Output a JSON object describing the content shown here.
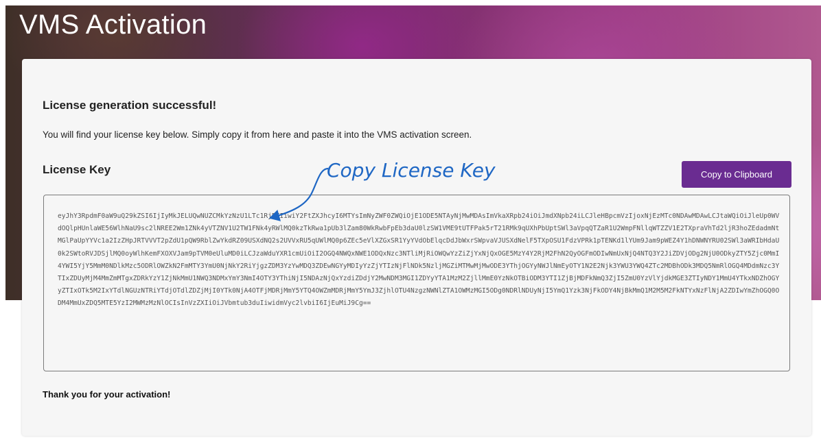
{
  "page": {
    "title": "VMS Activation"
  },
  "card": {
    "heading": "License generation successful!",
    "intro": "You will find your license key below. Simply copy it from here and paste it into the VMS activation screen.",
    "key_label": "License Key",
    "copy_button_label": "Copy to Clipboard",
    "license_key": "eyJhY3RpdmF0aW9uQ29kZSI6IjIyMkJELUQwNUZCMkYzNzU1LTc1RjBFIiwiY2FtZXJhcyI6MTYsImNyZWF0ZWQiOjE1ODE5NTAyNjMwMDAsImVkaXRpb24iOiJmdXNpb24iLCJleHBpcmVzIjoxNjEzMTc0NDAwMDAwLCJtaWQiOiJleUp0WVdOQlpHUnlaWE56WlhNaU9sc2lNREE2Wm1ZNk4yVTZNV1U2TW1FNk4yRWlMQ0kzTkRwa1pUb3lZam80WkRwbFpEb3daU0lzSW1VME9tUTFPak5rT21RMk9qUXhPbUptSWl3aVpqQTZaR1U2WmpFNllqWTZZV1E2TXpraVhTd2ljR3hoZEdadmNtMGlPaUpYYVc1a2IzZHpJRTVVVT2pZdU1pQW9RblZwYkdRZ09USXdNQ2s2UVVxRU5qUWlMQ0p6ZEc5eVlXZGxSR1YyYVdObElqcDdJbWxrSWpvaVJUSXdNelF5TXpOSU1FdzVPRk1pTENKd1lYUm9Jam9pWEZ4Y1hDNWNYRU02SWl3aWRIbHdaU0k2SWtoRVJDSjlMQ0oyWlhKemFXOXVJam9pTVM0eUluMD0iLCJzaWduYXR1cmUiOiI2OGQ4NWQxNWE1ODQxNzc3NTliMjRiOWQwYzZiZjYxNjQxOGE5MzY4Y2RjM2FhN2QyOGFmODIwNmUxNjQ4NTQ3Y2JiZDVjODg2NjU0ODkyZTY5Zjc0MmI4YWI5YjY5MmM0NDlkMzc5ODRlOWZkN2FmMTY3YmU0NjNkY2RiYjgzZDM3YzYwMDQ3ZDEwNGYyMDIyYzZjYTIzNjFlNDk5NzljMGZiMTMwMjMwODE3YThjOGYyNWJlNmEyOTY1N2E2Njk3YWU3YWQ4ZTc2MDBhODk3MDQ5NmRlOGQ4MDdmNzc3YTIxZDUyMjM4MmZmMTgxZDRkYzY1ZjNkMmU1NWQ3NDMxYmY3NmI4OTY3YThiNjI5NDAzNjQxYzdiZDdjY2MwNDM3MGI1ZDYyYTA1MzM2ZjllMmE0YzNkOTBiODM3YTI1ZjBjMDFkNmQ3ZjI5ZmU0YzVlYjdkMGE3ZTIyNDY1MmU4YTkxNDZhOGYyZTIxOTk5M2IxYTdlNGUzNTRiYTdjOTdlZDZjMjI0YTk0NjA4OTFjMDRjMmY5YTQ4OWZmMDRjMmY5YmJ3ZjhlOTU4NzgzNWNlZTA1OWMzMGI5ODg0NDRlNDUyNjI5YmQ1Yzk3NjFkODY4NjBkMmQ1M2M5M2FkNTYxNzFlNjA2ZDIwYmZhOGQ0ODM4MmUxZDQ5MTE5YzI2MWMzMzNlOCIsInVzZXIiOiJVbmtub3duIiwidmVyc2lvbiI6IjEuMiJ9Cg==",
    "thanks": "Thank you for your activation!"
  },
  "annotation": {
    "text": "Copy License Key",
    "color": "#1f67c4"
  },
  "colors": {
    "button": "#6a2c91",
    "card_bg": "#f6f6f6"
  }
}
